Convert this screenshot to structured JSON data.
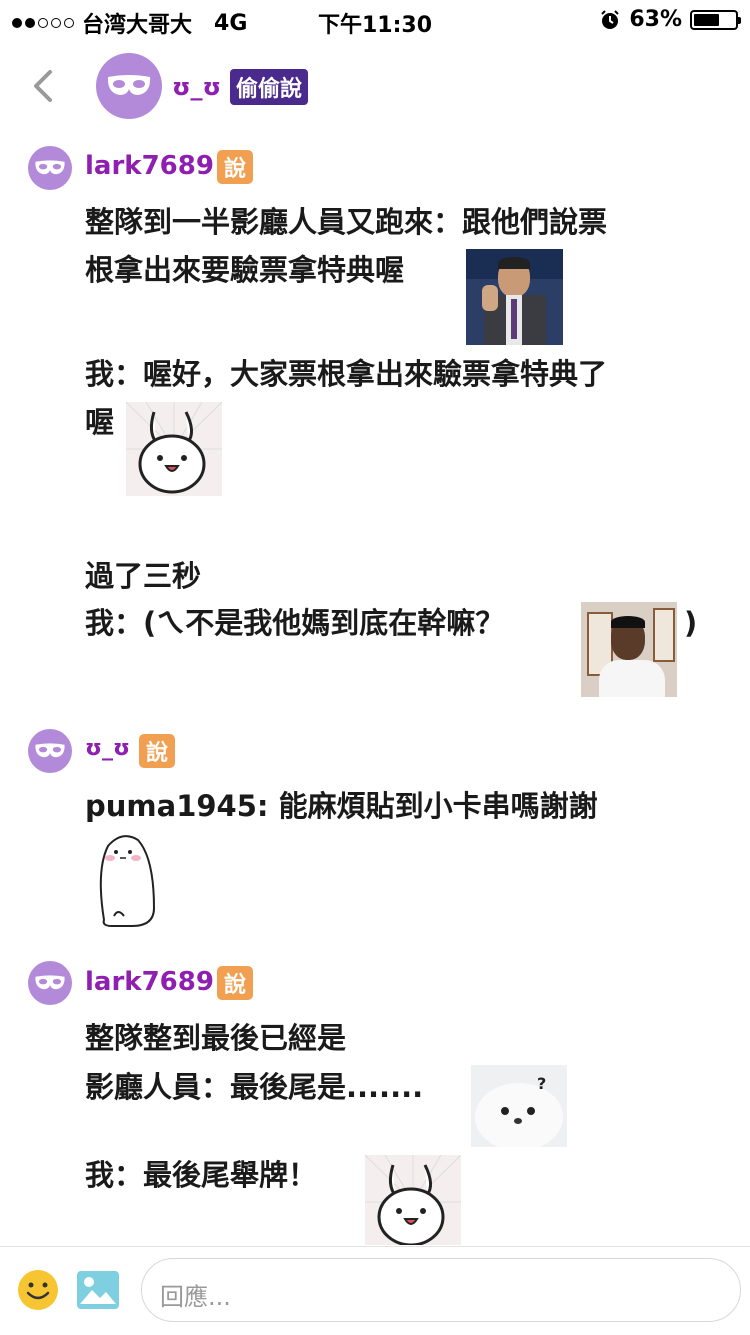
{
  "status_bar": {
    "carrier": "台湾大哥大",
    "network": "4G",
    "time": "下午11:30",
    "battery": "63%",
    "battery_level": 0.63,
    "signal_filled": 2,
    "signal_total": 5
  },
  "header": {
    "username": "ʊ_ʊ",
    "badge": "偷偷說"
  },
  "posts": [
    {
      "username": "lark7689",
      "badge": "說",
      "lines": [
        "整隊到一半影廳人員又跑來：跟他們說票",
        "根拿出來要驗票拿特典喔",
        "我：喔好，大家票根拿出來驗票拿特典了",
        "喔",
        "過了三秒",
        "我：(ㄟ不是我他媽到底在幹嘛？",
        ")"
      ]
    },
    {
      "username": "ʊ_ʊ",
      "badge": "說",
      "lines": [
        "puma1945: 能麻煩貼到小卡串嗎謝謝"
      ]
    },
    {
      "username": "lark7689",
      "badge": "說",
      "lines": [
        "整隊整到最後已經是",
        "影廳人員：最後尾是.......",
        "我：最後尾舉牌！"
      ]
    }
  ],
  "reply": {
    "placeholder": "回應..."
  },
  "colors": {
    "accent": "#8e1fb0",
    "avatar": "#b28ad9",
    "badge_dark": "#4a2a8c",
    "badge_orange": "#f0a050"
  },
  "icons": [
    "back-icon",
    "mask-icon",
    "smiley-icon",
    "image-icon"
  ]
}
